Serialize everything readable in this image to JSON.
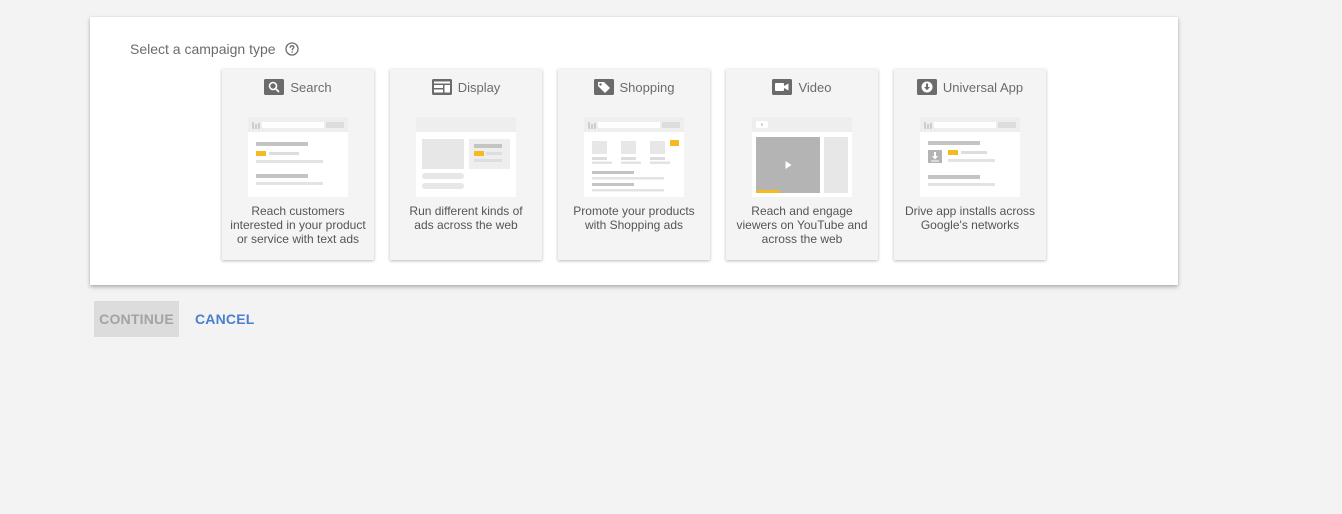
{
  "panel": {
    "title": "Select a campaign type",
    "help_icon": "help-circle-icon"
  },
  "cards": [
    {
      "id": "search",
      "title": "Search",
      "icon": "search-icon",
      "description_lines": [
        "Reach customers",
        "interested in your product",
        "or service with text ads"
      ]
    },
    {
      "id": "display",
      "title": "Display",
      "icon": "display-icon",
      "description_lines": [
        "Run different kinds of",
        "ads across the web"
      ]
    },
    {
      "id": "shopping",
      "title": "Shopping",
      "icon": "shopping-tag-icon",
      "description_lines": [
        "Promote your products",
        "with Shopping ads"
      ]
    },
    {
      "id": "video",
      "title": "Video",
      "icon": "video-camera-icon",
      "description_lines": [
        "Reach and engage",
        "viewers on YouTube and",
        "across the web"
      ]
    },
    {
      "id": "universal-app",
      "title": "Universal App",
      "icon": "download-app-icon",
      "description_lines": [
        "Drive app installs across",
        "Google's networks"
      ]
    }
  ],
  "actions": {
    "continue_label": "CONTINUE",
    "cancel_label": "CANCEL"
  },
  "colors": {
    "accent": "#4a7fcf",
    "highlight": "#f5b921",
    "icon": "#6b6b6b"
  }
}
